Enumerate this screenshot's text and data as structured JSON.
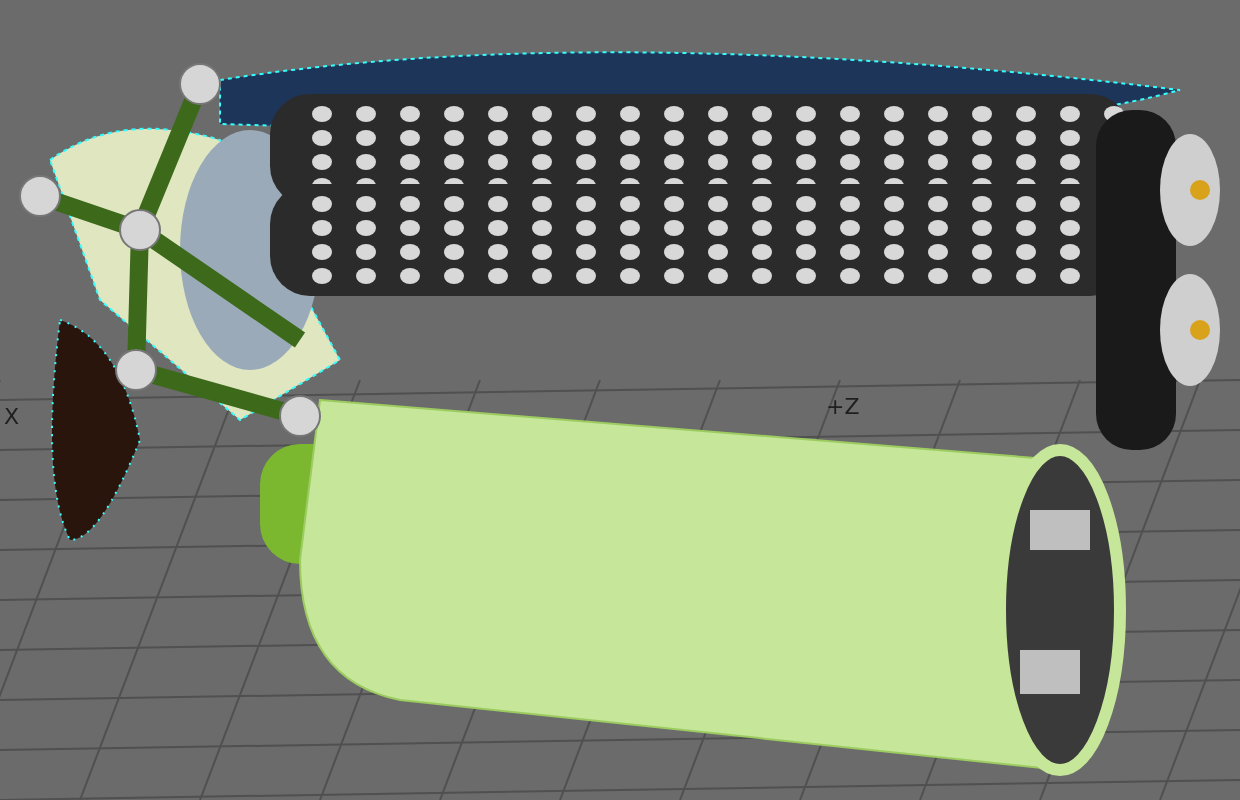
{
  "viewport": {
    "x_axis_label": "X",
    "z_axis_label": "+Z"
  }
}
